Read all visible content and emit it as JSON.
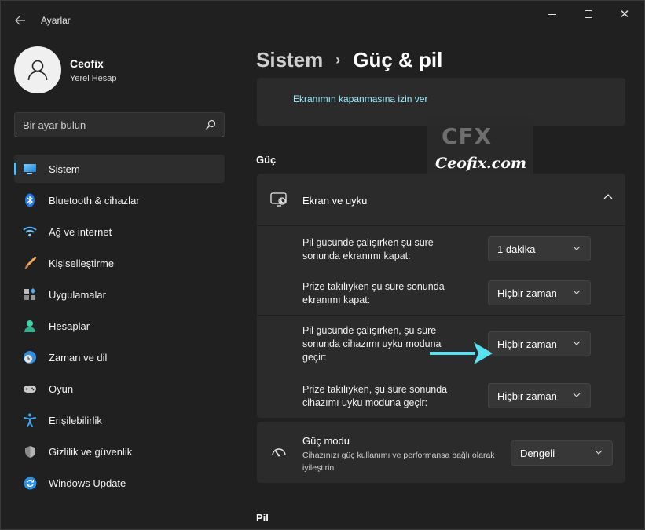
{
  "window": {
    "title": "Ayarlar",
    "back_icon": "back-arrow-icon",
    "controls": [
      "minimize-icon",
      "maximize-icon",
      "close-icon"
    ]
  },
  "profile": {
    "name": "Ceofix",
    "account_type": "Yerel Hesap"
  },
  "search": {
    "placeholder": "Bir ayar bulun"
  },
  "sidebar": {
    "items": [
      {
        "label": "Sistem",
        "icon": "display-icon",
        "active": true
      },
      {
        "label": "Bluetooth & cihazlar",
        "icon": "bluetooth-icon"
      },
      {
        "label": "Ağ ve internet",
        "icon": "wifi-icon"
      },
      {
        "label": "Kişiselleştirme",
        "icon": "brush-icon"
      },
      {
        "label": "Uygulamalar",
        "icon": "apps-icon"
      },
      {
        "label": "Hesaplar",
        "icon": "person-icon"
      },
      {
        "label": "Zaman ve dil",
        "icon": "clock-globe-icon"
      },
      {
        "label": "Oyun",
        "icon": "gamepad-icon"
      },
      {
        "label": "Erişilebilirlik",
        "icon": "accessibility-icon"
      },
      {
        "label": "Gizlilik ve güvenlik",
        "icon": "shield-icon"
      },
      {
        "label": "Windows Update",
        "icon": "update-icon"
      }
    ]
  },
  "breadcrumb": {
    "parent": "Sistem",
    "separator": "›",
    "current": "Güç & pil"
  },
  "top_card": {
    "link": "Ekranımın kapanmasına izin ver"
  },
  "sections": {
    "power": "Güç",
    "battery": "Pil"
  },
  "screen_sleep": {
    "title": "Ekran ve uyku",
    "expanded": true,
    "rows": [
      {
        "label": "Pil gücünde çalışırken şu süre sonunda ekranımı kapat:",
        "value": "1 dakika"
      },
      {
        "label": "Prize takılıyken şu süre sonunda ekranımı kapat:",
        "value": "Hiçbir zaman"
      },
      {
        "label": "Pil gücünde çalışırken, şu süre sonunda cihazımı uyku moduna geçir:",
        "value": "Hiçbir zaman"
      },
      {
        "label": "Prize takılıyken, şu süre sonunda cihazımı uyku moduna geçir:",
        "value": "Hiçbir zaman"
      }
    ]
  },
  "power_mode": {
    "title": "Güç modu",
    "description": "Cihazınızı güç kullanımı ve performansa bağlı olarak iyileştirin",
    "value": "Dengeli"
  },
  "watermark": {
    "logo": "CFX",
    "text": "Ceofix.com"
  },
  "colors": {
    "accent": "#4cc2ff",
    "link": "#99ebff",
    "arrow": "#58e1ef"
  }
}
